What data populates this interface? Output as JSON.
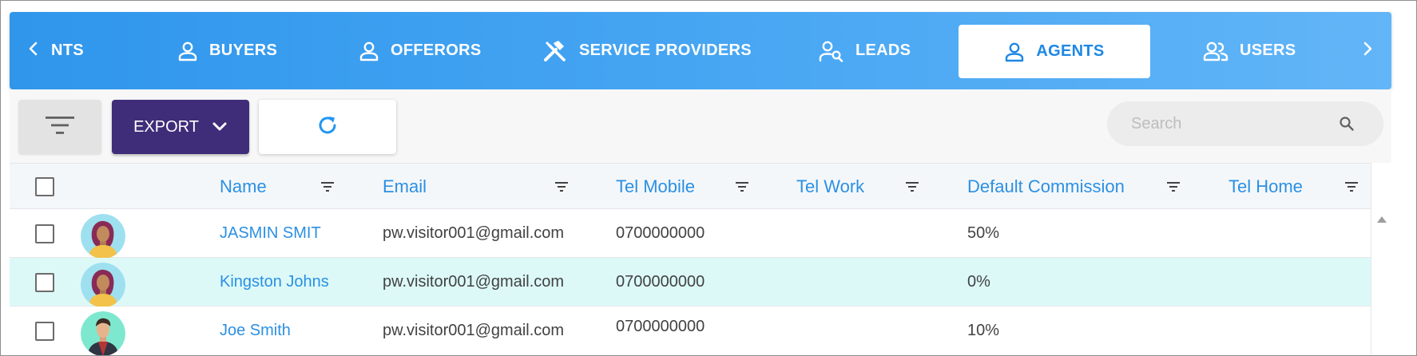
{
  "tabs": {
    "prev_arrow": "chevron-left-icon",
    "next_arrow": "chevron-right-icon",
    "items": [
      {
        "label": "NTS",
        "icon": "none",
        "active": false
      },
      {
        "label": "BUYERS",
        "icon": "person-icon",
        "active": false
      },
      {
        "label": "OFFERORS",
        "icon": "person-icon",
        "active": false
      },
      {
        "label": "SERVICE PROVIDERS",
        "icon": "tools-icon",
        "active": false
      },
      {
        "label": "LEADS",
        "icon": "person-search-icon",
        "active": false
      },
      {
        "label": "AGENTS",
        "icon": "person-icon",
        "active": true
      },
      {
        "label": "USERS",
        "icon": "people-icon",
        "active": false
      }
    ]
  },
  "toolbar": {
    "export_label": "EXPORT",
    "search_placeholder": "Search"
  },
  "table": {
    "columns": [
      "Name",
      "Email",
      "Tel Mobile",
      "Tel Work",
      "Default Commission",
      "Tel Home"
    ],
    "rows": [
      {
        "name": "JASMIN SMIT",
        "email": "pw.visitor001@gmail.com",
        "tel_mobile": "0700000000",
        "tel_work": "",
        "commission": "50%",
        "tel_home": "",
        "avatar": "female-avatar",
        "highlighted": false
      },
      {
        "name": "Kingston Johns",
        "email": "pw.visitor001@gmail.com",
        "tel_mobile": "0700000000",
        "tel_work": "",
        "commission": "0%",
        "tel_home": "",
        "avatar": "female-avatar",
        "highlighted": true
      },
      {
        "name": "Joe Smith",
        "email": "pw.visitor001@gmail.com",
        "tel_mobile": "0700000000",
        "tel_work": "",
        "commission": "10%",
        "tel_home": "",
        "avatar": "male-avatar",
        "highlighted": false
      }
    ]
  },
  "colors": {
    "tab_gradient_start": "#2f96ec",
    "tab_gradient_end": "#62b5f7",
    "export_button": "#3f2d7a",
    "link_blue": "#2b90e3",
    "row_highlight": "#dcf9f8"
  }
}
